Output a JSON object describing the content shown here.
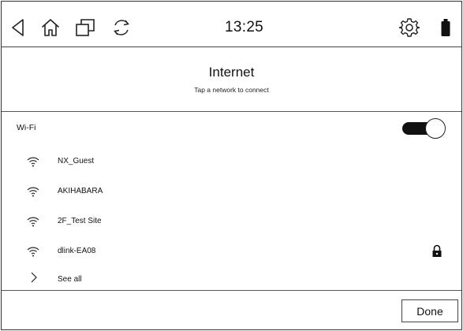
{
  "status_bar": {
    "time": "13:25",
    "icons": [
      "back-icon",
      "home-icon",
      "recent-apps-icon",
      "refresh-icon",
      "settings-gear-icon",
      "battery-icon"
    ]
  },
  "header": {
    "title": "Internet",
    "subtitle": "Tap a network to connect"
  },
  "wifi": {
    "label": "Wi-Fi",
    "enabled": true
  },
  "networks": [
    {
      "name": "NX_Guest",
      "secured": false
    },
    {
      "name": "AKIHABARA",
      "secured": false
    },
    {
      "name": "2F_Test Site",
      "secured": false
    },
    {
      "name": "dlink-EA08",
      "secured": true
    }
  ],
  "see_all": {
    "label": "See all"
  },
  "footer": {
    "done_label": "Done"
  },
  "colors": {
    "foreground": "#111111",
    "background": "#ffffff"
  }
}
